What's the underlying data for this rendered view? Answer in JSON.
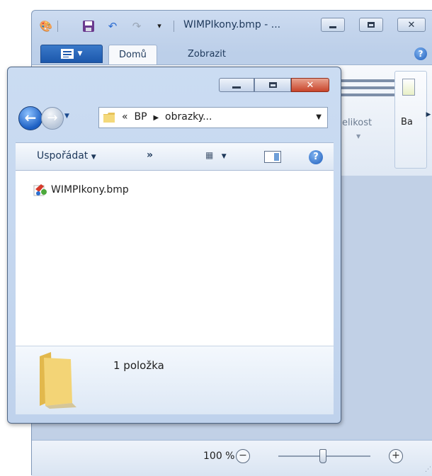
{
  "paint": {
    "title": "WIMPIkony.bmp - ...",
    "tabs": [
      {
        "label": "Domů"
      },
      {
        "label": "Zobrazit"
      }
    ],
    "ribbon": {
      "size_label": "elikost",
      "partial_label": "Ba"
    },
    "status": {
      "zoom": "100 %",
      "zoom_value_fraction": 0.5
    }
  },
  "explorer": {
    "address": {
      "overflow": "«",
      "segment1": "BP",
      "segment2": "obrazky..."
    },
    "toolbar": {
      "organize_label": "Uspořádat",
      "more_label": "»"
    },
    "files": [
      {
        "name": "WIMPIkony.bmp",
        "icon": "paint-bitmap-icon"
      }
    ],
    "details": {
      "item_count": "1 položka"
    }
  },
  "colors": {
    "accent": "#1c58ac",
    "window_frame": "#bfd2ec",
    "close_button": "#c8442a"
  }
}
